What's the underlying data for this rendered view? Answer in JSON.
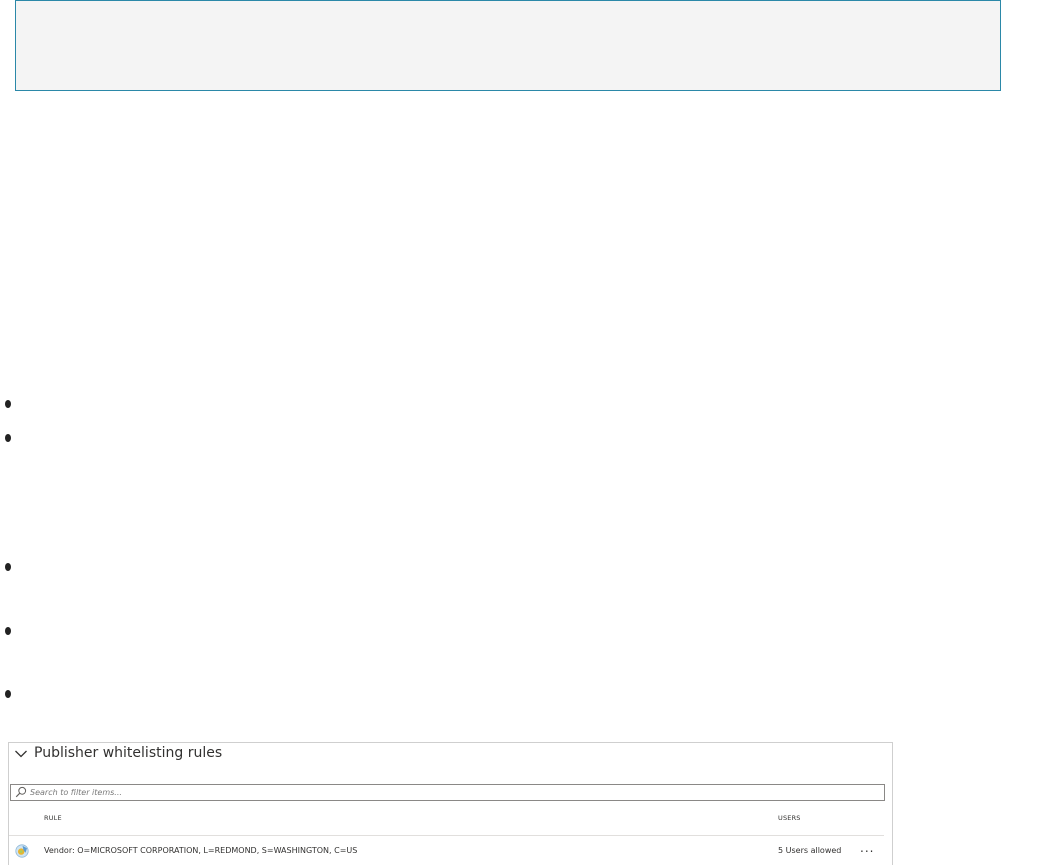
{
  "panel": {
    "title": "Publisher whitelisting rules",
    "search_placeholder": "Search to filter items...",
    "columns": {
      "rule": "RULE",
      "users": "USERS"
    },
    "rows": [
      {
        "rule": "Vendor: O=MICROSOFT CORPORATION, L=REDMOND, S=WASHINGTON, C=US",
        "users": "5 Users allowed",
        "more_label": "..."
      }
    ]
  },
  "colors": {
    "note_border": "#2b88a8",
    "note_background": "#f4f4f4",
    "panel_border": "#cfcfcf"
  },
  "icons": {
    "collapse": "chevron-down-icon",
    "search": "search-icon",
    "rule": "certificate-rule-icon",
    "more": "more-icon"
  }
}
